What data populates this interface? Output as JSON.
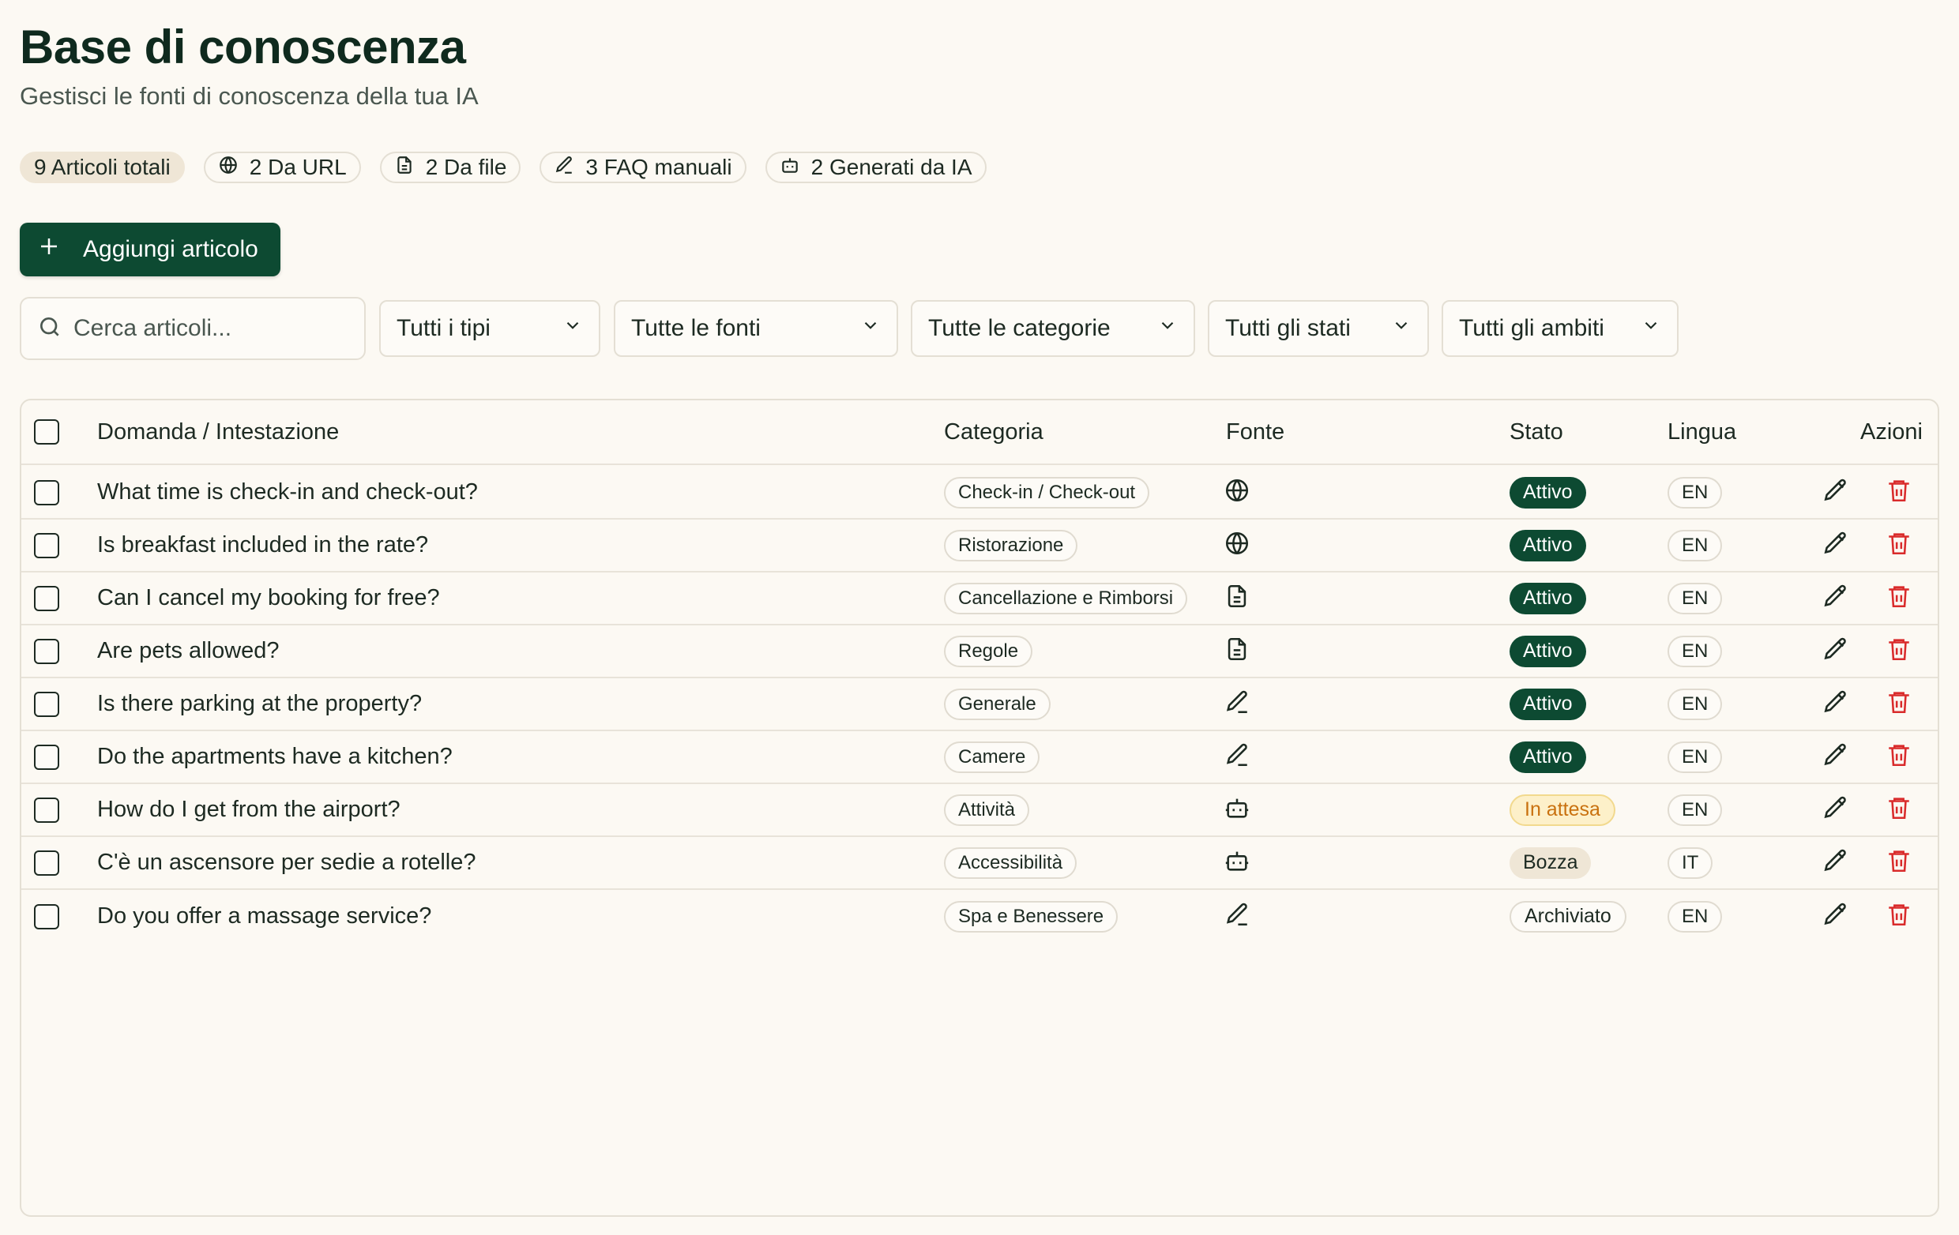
{
  "header": {
    "title": "Base di conoscenza",
    "subtitle": "Gestisci le fonti di conoscenza della tua IA"
  },
  "stats": {
    "total": "9 Articoli totali",
    "url": "2 Da URL",
    "file": "2 Da file",
    "manual": "3 FAQ manuali",
    "ai": "2 Generati da IA"
  },
  "toolbar": {
    "add_label": "Aggiungi articolo"
  },
  "filters": {
    "search_placeholder": "Cerca articoli...",
    "types": "Tutti i tipi",
    "sources": "Tutte le fonti",
    "categories": "Tutte le categorie",
    "states": "Tutti gli stati",
    "scopes": "Tutti gli ambiti"
  },
  "table": {
    "headers": {
      "question": "Domanda / Intestazione",
      "category": "Categoria",
      "source": "Fonte",
      "status": "Stato",
      "language": "Lingua",
      "actions": "Azioni"
    },
    "rows": [
      {
        "question": "What time is check-in and check-out?",
        "category": "Check-in / Check-out",
        "source": "globe-icon",
        "status": "Attivo",
        "status_type": "active",
        "language": "EN"
      },
      {
        "question": "Is breakfast included in the rate?",
        "category": "Ristorazione",
        "source": "globe-icon",
        "status": "Attivo",
        "status_type": "active",
        "language": "EN"
      },
      {
        "question": "Can I cancel my booking for free?",
        "category": "Cancellazione e Rimborsi",
        "source": "file-icon",
        "status": "Attivo",
        "status_type": "active",
        "language": "EN"
      },
      {
        "question": "Are pets allowed?",
        "category": "Regole",
        "source": "file-icon",
        "status": "Attivo",
        "status_type": "active",
        "language": "EN"
      },
      {
        "question": "Is there parking at the property?",
        "category": "Generale",
        "source": "pencil-icon",
        "status": "Attivo",
        "status_type": "active",
        "language": "EN"
      },
      {
        "question": "Do the apartments have a kitchen?",
        "category": "Camere",
        "source": "pencil-icon",
        "status": "Attivo",
        "status_type": "active",
        "language": "EN"
      },
      {
        "question": "How do I get from the airport?",
        "category": "Attività",
        "source": "bot-icon",
        "status": "In attesa",
        "status_type": "pending",
        "language": "EN"
      },
      {
        "question": "C'è un ascensore per sedie a rotelle?",
        "category": "Accessibilità",
        "source": "bot-icon",
        "status": "Bozza",
        "status_type": "draft",
        "language": "IT"
      },
      {
        "question": "Do you offer a massage service?",
        "category": "Spa e Benessere",
        "source": "pencil-icon",
        "status": "Archiviato",
        "status_type": "archived",
        "language": "EN"
      }
    ]
  },
  "colors": {
    "background": "#fcf9f3",
    "brand": "#0d4a32",
    "danger": "#d92b2b",
    "pending": "#c9710f"
  }
}
